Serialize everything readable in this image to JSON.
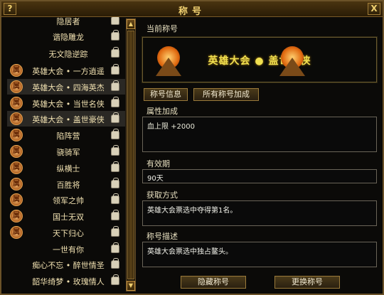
{
  "window": {
    "title": "称号",
    "help_label": "?",
    "close_label": "X"
  },
  "list": {
    "items": [
      {
        "label": "隐居者",
        "badge": ""
      },
      {
        "label": "谐隐雕龙",
        "badge": ""
      },
      {
        "label": "无文隐逆踪",
        "badge": ""
      },
      {
        "label": "英雄大会 • 一方逍遥",
        "badge": "属"
      },
      {
        "label": "英雄大会 • 四海英杰",
        "badge": "属"
      },
      {
        "label": "英雄大会 • 当世名侠",
        "badge": "属"
      },
      {
        "label": "英雄大会 • 盖世豪侠",
        "badge": "属"
      },
      {
        "label": "陷阵营",
        "badge": "属"
      },
      {
        "label": "骁骑军",
        "badge": "属"
      },
      {
        "label": "纵横士",
        "badge": "属"
      },
      {
        "label": "百胜将",
        "badge": "属"
      },
      {
        "label": "领军之帅",
        "badge": "属"
      },
      {
        "label": "国士无双",
        "badge": "属"
      },
      {
        "label": "天下归心",
        "badge": "属"
      },
      {
        "label": "一世有你",
        "badge": ""
      },
      {
        "label": "痴心不忘 • 醉世情圣",
        "badge": ""
      },
      {
        "label": "韶华绮梦 • 玫瑰情人",
        "badge": ""
      }
    ]
  },
  "scroll": {
    "up": "▲",
    "down": "▼"
  },
  "current": {
    "label": "当前称号",
    "banner_title": "英雄大会 ● 盖世豪侠"
  },
  "tabs": {
    "info": "称号信息",
    "all_bonus": "所有称号加成"
  },
  "attributes": {
    "label": "属性加成",
    "value": "血上限 +2000"
  },
  "validity": {
    "label": "有效期",
    "value": "90天"
  },
  "acquire": {
    "label": "获取方式",
    "value": "英雄大会票选中夺得第1名。"
  },
  "description": {
    "label": "称号描述",
    "value": "英雄大会票选中独占鳌头。"
  },
  "buttons": {
    "hide": "隐藏称号",
    "change": "更换称号"
  },
  "colors": {
    "accent": "#f0d070",
    "banner_text": "#f0e050",
    "frame": "#6b5228"
  }
}
